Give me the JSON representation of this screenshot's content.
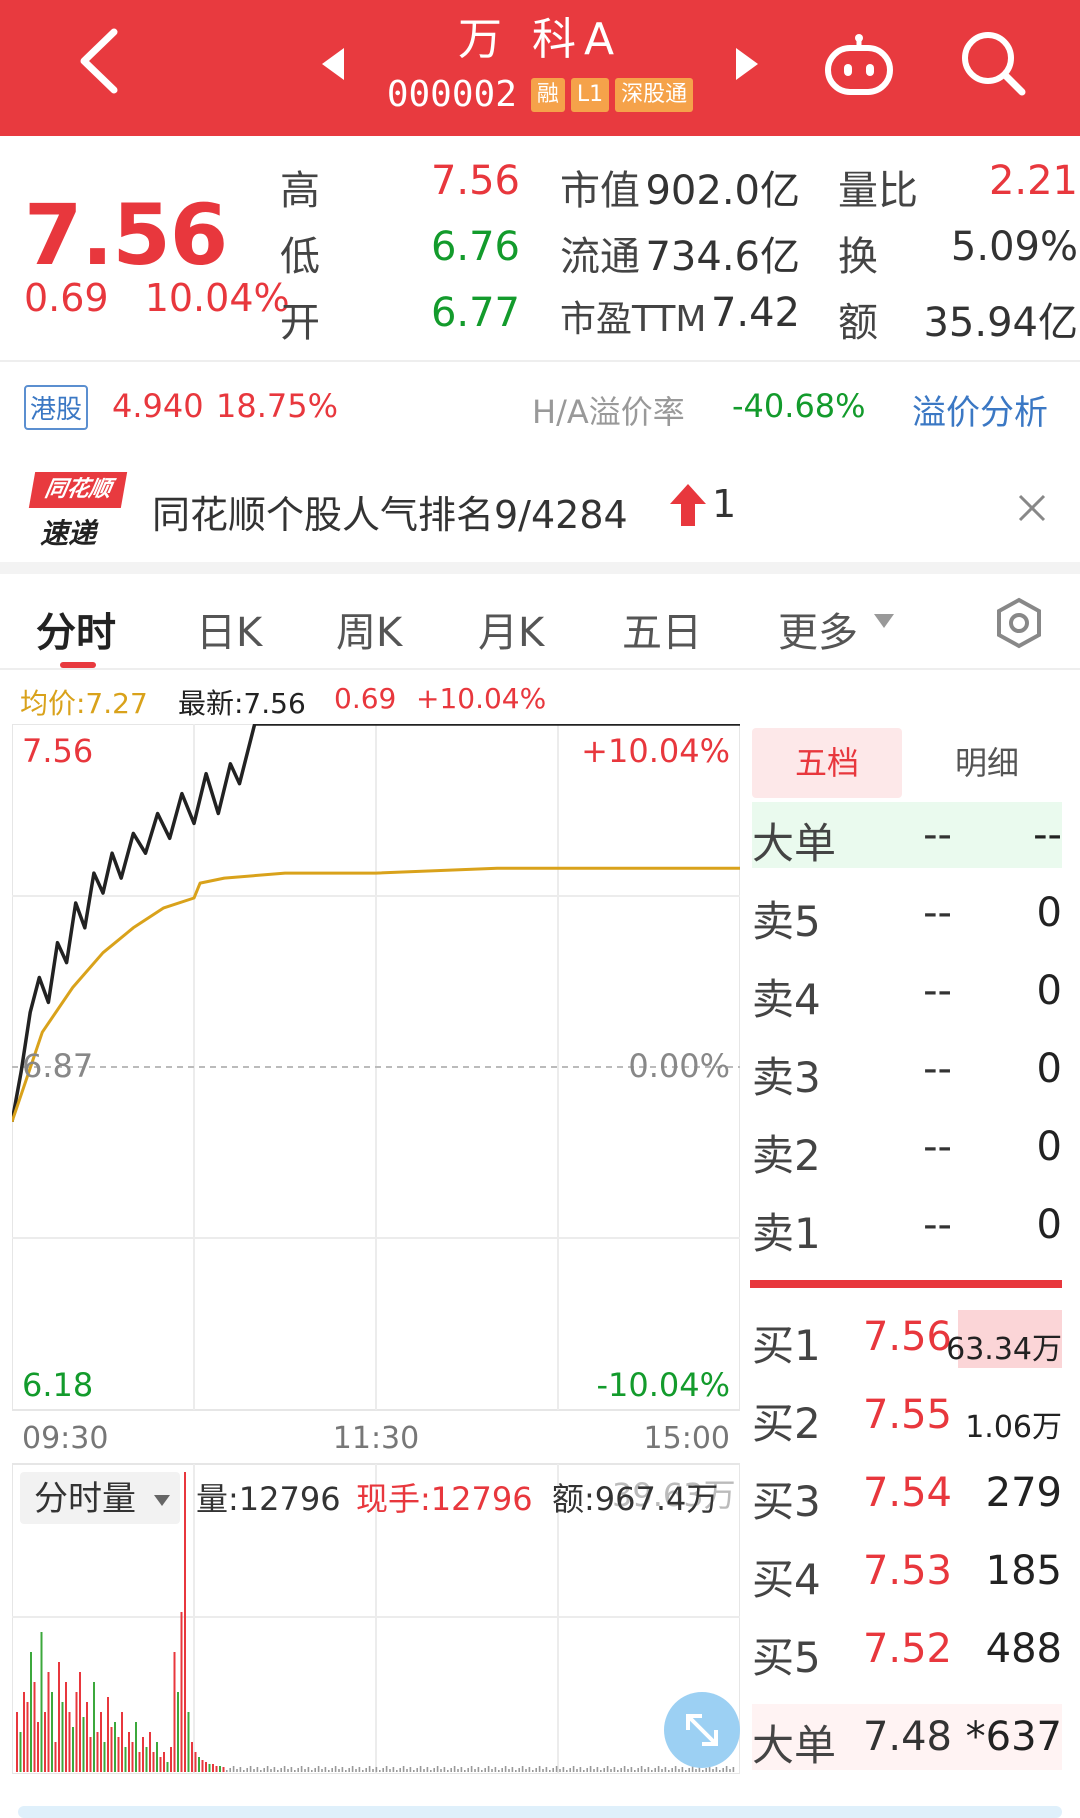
{
  "header": {
    "name": "万 科A",
    "code": "000002",
    "tags": [
      "融",
      "L1",
      "深股通"
    ]
  },
  "quote": {
    "price": "7.56",
    "change": "0.69",
    "change_pct": "10.04%",
    "high_label": "高",
    "high": "7.56",
    "low_label": "低",
    "low": "6.76",
    "open_label": "开",
    "open": "6.77",
    "mcap_label": "市值",
    "mcap": "902.0亿",
    "float_label": "流通",
    "float": "734.6亿",
    "pe_label": "市盈TTM",
    "pe": "7.42",
    "vr_label": "量比",
    "vr": "2.21",
    "turnover_label": "换",
    "turnover": "5.09%",
    "amount_label": "额",
    "amount": "35.94亿"
  },
  "hk": {
    "tag": "港股",
    "price": "4.940",
    "change_pct": "18.75%",
    "premium_label": "H/A溢价率",
    "premium": "-40.68%",
    "link": "溢价分析"
  },
  "rank": {
    "logo_top": "同花顺",
    "logo_bottom": "速递",
    "text": "同花顺个股人气排名9/4284",
    "delta": "1"
  },
  "tabs": [
    "分时",
    "日K",
    "周K",
    "月K",
    "五日",
    "更多"
  ],
  "info_bar": {
    "avg": "均价:7.27",
    "latest": "最新:7.56",
    "change": "0.69",
    "change_pct": "+10.04%"
  },
  "chart_data": {
    "type": "line",
    "x_ticks": [
      "09:30",
      "11:30",
      "15:00"
    ],
    "y_labels_left": [
      "7.56",
      "6.87",
      "6.18"
    ],
    "y_labels_right": [
      "+10.04%",
      "0.00%",
      "-10.04%"
    ],
    "ylim": [
      6.18,
      7.56
    ],
    "series": [
      {
        "name": "最新",
        "color": "#222222",
        "x": [
          0,
          3,
          6,
          9,
          12,
          15,
          18,
          21,
          24,
          27,
          30,
          33,
          36,
          40,
          44,
          48,
          52,
          56,
          60,
          64,
          68,
          72,
          75,
          80,
          90,
          120,
          160,
          200,
          240
        ],
        "values": [
          6.76,
          6.86,
          6.98,
          7.05,
          7.0,
          7.12,
          7.08,
          7.2,
          7.15,
          7.26,
          7.22,
          7.3,
          7.25,
          7.34,
          7.3,
          7.38,
          7.33,
          7.42,
          7.36,
          7.46,
          7.38,
          7.48,
          7.44,
          7.56,
          7.56,
          7.56,
          7.56,
          7.56,
          7.56
        ]
      },
      {
        "name": "均价",
        "color": "#d9a21b",
        "x": [
          0,
          5,
          10,
          20,
          30,
          40,
          50,
          60,
          62,
          70,
          90,
          120,
          160,
          200,
          240
        ],
        "values": [
          6.76,
          6.85,
          6.94,
          7.03,
          7.1,
          7.15,
          7.19,
          7.21,
          7.24,
          7.25,
          7.26,
          7.26,
          7.27,
          7.27,
          7.27
        ]
      }
    ],
    "volume": {
      "selector": "分时量",
      "vol": "量:12796",
      "now": "现手:12796",
      "amount": "额:967.4万",
      "amount_faded": "39.63万"
    }
  },
  "orderbook": {
    "tab_active": "五档",
    "tab_inactive": "明细",
    "big": {
      "label": "大单",
      "price": "--",
      "vol": "--"
    },
    "asks": [
      {
        "label": "卖5",
        "price": "--",
        "vol": "0"
      },
      {
        "label": "卖4",
        "price": "--",
        "vol": "0"
      },
      {
        "label": "卖3",
        "price": "--",
        "vol": "0"
      },
      {
        "label": "卖2",
        "price": "--",
        "vol": "0"
      },
      {
        "label": "卖1",
        "price": "--",
        "vol": "0"
      }
    ],
    "bids": [
      {
        "label": "买1",
        "price": "7.56",
        "vol": "63.34万"
      },
      {
        "label": "买2",
        "price": "7.55",
        "vol": "1.06万"
      },
      {
        "label": "买3",
        "price": "7.54",
        "vol": "279"
      },
      {
        "label": "买4",
        "price": "7.53",
        "vol": "185"
      },
      {
        "label": "买5",
        "price": "7.52",
        "vol": "488"
      }
    ],
    "big_bottom": {
      "label": "大单",
      "price": "7.48",
      "vol": "*637"
    }
  },
  "colors": {
    "brand": "#e83a3f",
    "up": "#e8373d",
    "down": "#139b2c",
    "avg": "#d9a21b"
  }
}
